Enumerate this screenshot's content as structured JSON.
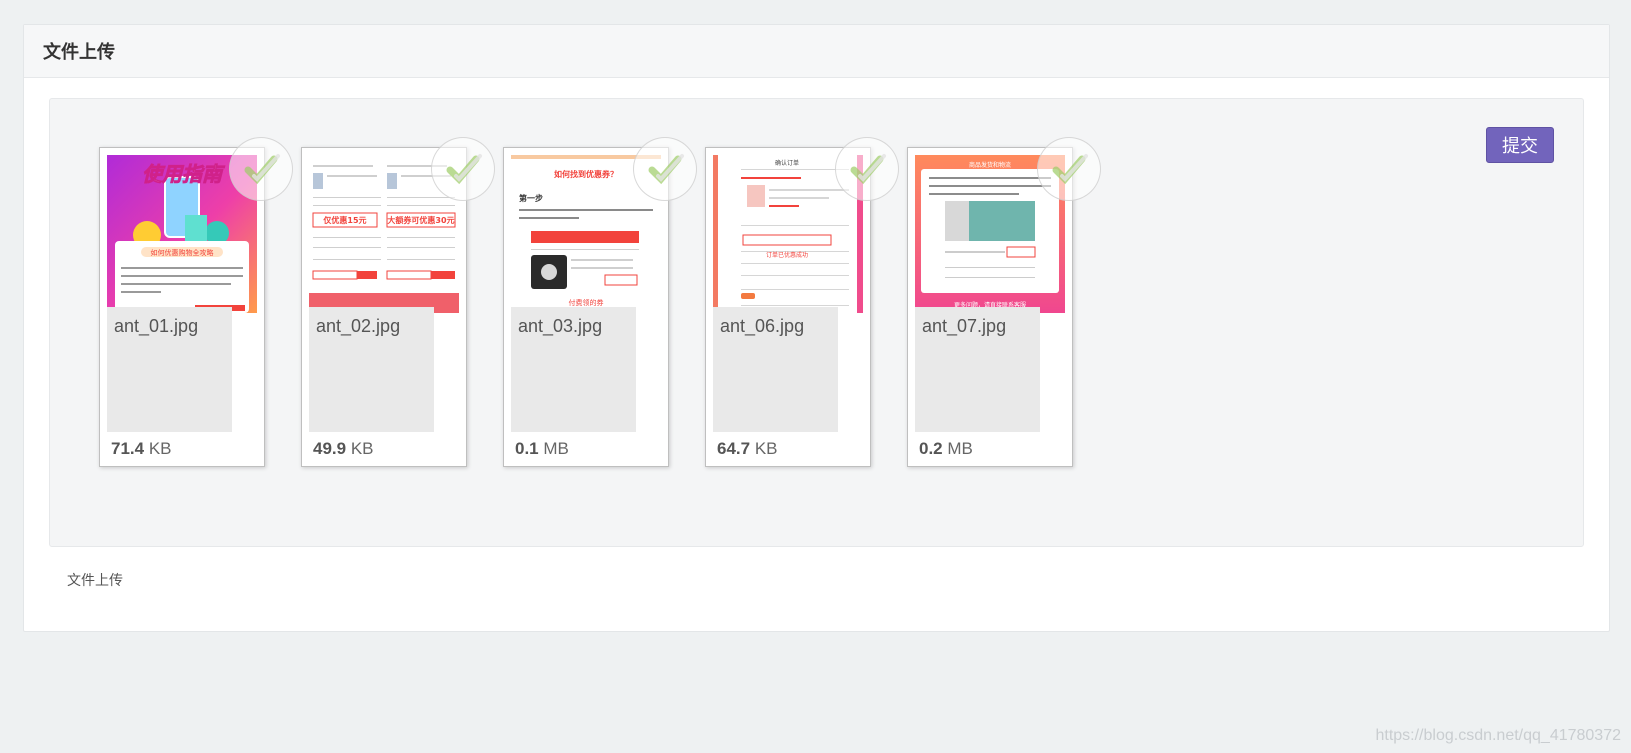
{
  "panel": {
    "title": "文件上传",
    "footer_text": "文件上传"
  },
  "uploader": {
    "submit_label": "提交",
    "files": [
      {
        "name": "ant_01.jpg",
        "size_value": "71.4",
        "size_unit": "KB",
        "status": "uploaded"
      },
      {
        "name": "ant_02.jpg",
        "size_value": "49.9",
        "size_unit": "KB",
        "status": "uploaded"
      },
      {
        "name": "ant_03.jpg",
        "size_value": "0.1",
        "size_unit": "MB",
        "status": "uploaded"
      },
      {
        "name": "ant_06.jpg",
        "size_value": "64.7",
        "size_unit": "KB",
        "status": "uploaded"
      },
      {
        "name": "ant_07.jpg",
        "size_value": "0.2",
        "size_unit": "MB",
        "status": "uploaded"
      }
    ]
  },
  "thumbnails": {
    "ant_01": {
      "banner_text": "使用指南",
      "card_title": "如何优惠购物全攻略"
    },
    "ant_02": {
      "left_red_text": "仅优惠15元",
      "right_red_text": "大额券可优惠30元"
    },
    "ant_03": {
      "title": "如何找到优惠券？",
      "step": "第一步",
      "red_caption": "付费领的券"
    },
    "ant_06": {
      "top_title": "确认订单",
      "red_caption": "订单已优惠成功"
    },
    "ant_07": {
      "header_text": "商品发货和物流",
      "footer_text": "更多问题，请直接联系客服"
    }
  },
  "watermark": "https://blog.csdn.net/qq_41780372",
  "colors": {
    "submit_bg": "#7264bc",
    "check_green": "#8bc34a",
    "thumb_red": "#f2433c",
    "thumb_pink": "#f04c8c"
  }
}
